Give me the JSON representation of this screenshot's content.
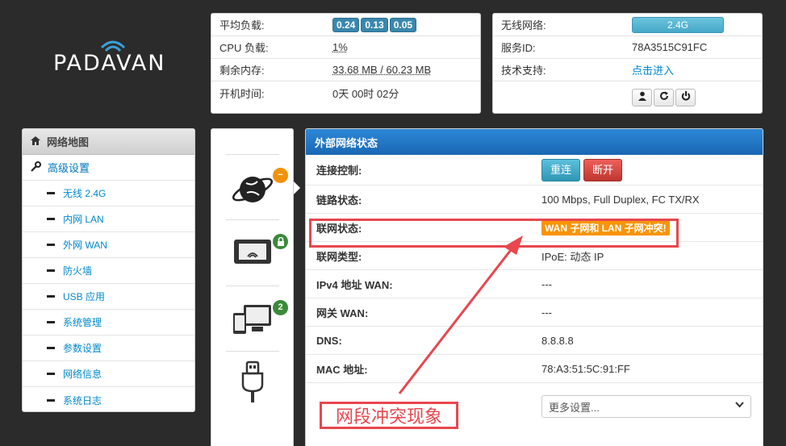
{
  "logo": {
    "text": "PADAVAN"
  },
  "stats": {
    "rows": [
      {
        "label": "平均负载:",
        "values": [
          "0.24",
          "0.13",
          "0.05"
        ]
      },
      {
        "label": "CPU 负载:",
        "value": "1%"
      },
      {
        "label": "剩余内存:",
        "value": "33.68 MB / 60.23 MB"
      },
      {
        "label": "开机时间:",
        "value": "0天 00时 02分"
      }
    ]
  },
  "info": {
    "wireless_label": "无线网络:",
    "wireless_btn": "2.4G",
    "service_label": "服务ID:",
    "service_value": "78A3515C91FC",
    "support_label": "技术支持:",
    "support_link": "点击进入",
    "icons": [
      "user-icon",
      "refresh-icon",
      "power-icon"
    ]
  },
  "sidebar": {
    "header": "网络地图",
    "advanced": "高级设置",
    "items": [
      "无线 2.4G",
      "内网 LAN",
      "外网 WAN",
      "防火墙",
      "USB 应用",
      "系统管理",
      "参数设置",
      "网络信息",
      "系统日志"
    ]
  },
  "devices": {
    "internet_badge": "−",
    "client_badge": "2"
  },
  "wan": {
    "title": "外部网络状态",
    "rows": [
      {
        "label": "连接控制:",
        "type": "buttons",
        "buttons": [
          "重连",
          "断开"
        ]
      },
      {
        "label": "链路状态:",
        "value": "100 Mbps, Full Duplex, FC TX/RX"
      },
      {
        "label": "联网状态:",
        "type": "warn",
        "value": "WAN 子网和 LAN 子网冲突!"
      },
      {
        "label": "联网类型:",
        "value": "IPoE: 动态 IP"
      },
      {
        "label": "IPv4 地址 WAN:",
        "value": "---"
      },
      {
        "label": "网关 WAN:",
        "value": "---"
      },
      {
        "label": "DNS:",
        "value": "8.8.8.8"
      },
      {
        "label": "MAC 地址:",
        "value": "78:A3:51:5C:91:FF"
      }
    ],
    "select_value": "更多设置..."
  },
  "annotation": {
    "note": "网段冲突现象"
  },
  "colors": {
    "accent": "#1a6fc0",
    "danger": "#e8474e",
    "warn": "#f89406"
  }
}
